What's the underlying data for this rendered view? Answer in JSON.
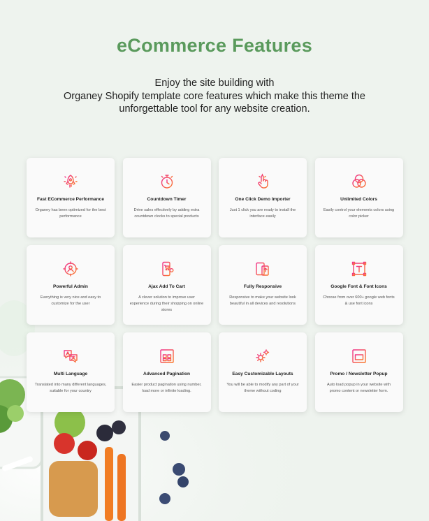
{
  "header": {
    "title": "eCommerce Features",
    "intro_lines": [
      "Enjoy the site building with",
      "Organey Shopify template core features which make this theme the",
      "unforgettable tool for any website creation."
    ]
  },
  "colors": {
    "title_green": "#5a9a5c",
    "icon_gradient_start": "#f0308a",
    "icon_gradient_end": "#fa7a2c",
    "background": "#eef3ee"
  },
  "features": [
    {
      "name": "Fast ECommerce Performance",
      "desc": "Organey has been optimized for the best performance",
      "icon": "rocket-icon"
    },
    {
      "name": "Countdown Timer",
      "desc": "Drive sales effectively by adding extra countdown clocks to special products",
      "icon": "stopwatch-icon"
    },
    {
      "name": "One Click Demo Importer",
      "desc": "Just 1 click you are ready to install the interface easily",
      "icon": "tap-hand-icon"
    },
    {
      "name": "Unlimited Colors",
      "desc": "Easily control your elements colors using color picker",
      "icon": "color-circles-icon"
    },
    {
      "name": "Powerful Admin",
      "desc": "Everything is very nice and easy to customize for the user",
      "icon": "admin-target-icon"
    },
    {
      "name": "Ajax Add To Cart",
      "desc": "A clever solution to improve user experience during their shopping on online stores",
      "icon": "mobile-cart-icon"
    },
    {
      "name": "Fully Responsive",
      "desc": "Responsive to make your website look beautiful in all devices and resolutions",
      "icon": "responsive-devices-icon"
    },
    {
      "name": "Google Font & Font Icons",
      "desc": "Choose from over 600+ google web fonts & use font icons",
      "icon": "font-frame-icon"
    },
    {
      "name": "Multi Language",
      "desc": "Translated into many different languages, suitable for your country",
      "icon": "translate-icon"
    },
    {
      "name": "Advanced Pagination",
      "desc": "Easier product pagination using number, load more or infinite loading.",
      "icon": "pagination-grid-icon"
    },
    {
      "name": "Easy Customizable Layouts",
      "desc": "You will be able to modify any part of your theme without coding",
      "icon": "gears-icon"
    },
    {
      "name": "Promo / Newsletter Popup",
      "desc": "Auto load popup in your website with promo content or newsletter form.",
      "icon": "popup-window-icon"
    }
  ]
}
